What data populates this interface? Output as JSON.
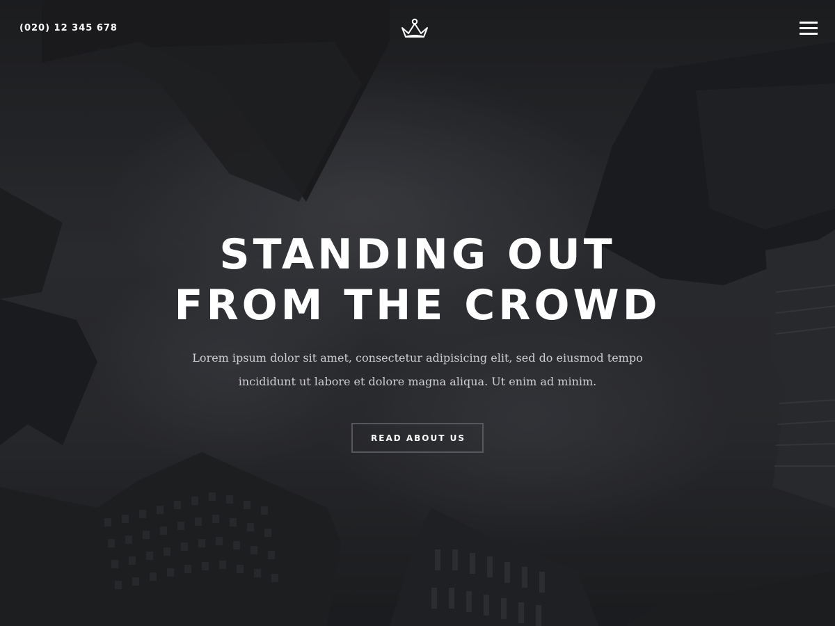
{
  "header": {
    "phone": "(020) 12 345 678",
    "logo_icon": "crown-icon",
    "menu_icon": "hamburger-menu-icon"
  },
  "hero": {
    "headline_line1": "STANDING OUT",
    "headline_line2": "FROM THE CROWD",
    "subtitle": "Lorem ipsum dolor sit amet, consectetur adipisicing elit, sed do eiusmod tempo incididunt ut labore et dolore magna aliqua. Ut enim ad minim.",
    "cta_label": "READ ABOUT US"
  },
  "colors": {
    "background": "#26272b",
    "text": "#ffffff",
    "subtitle_text": "#cfcfd2",
    "button_border": "#55575c"
  }
}
